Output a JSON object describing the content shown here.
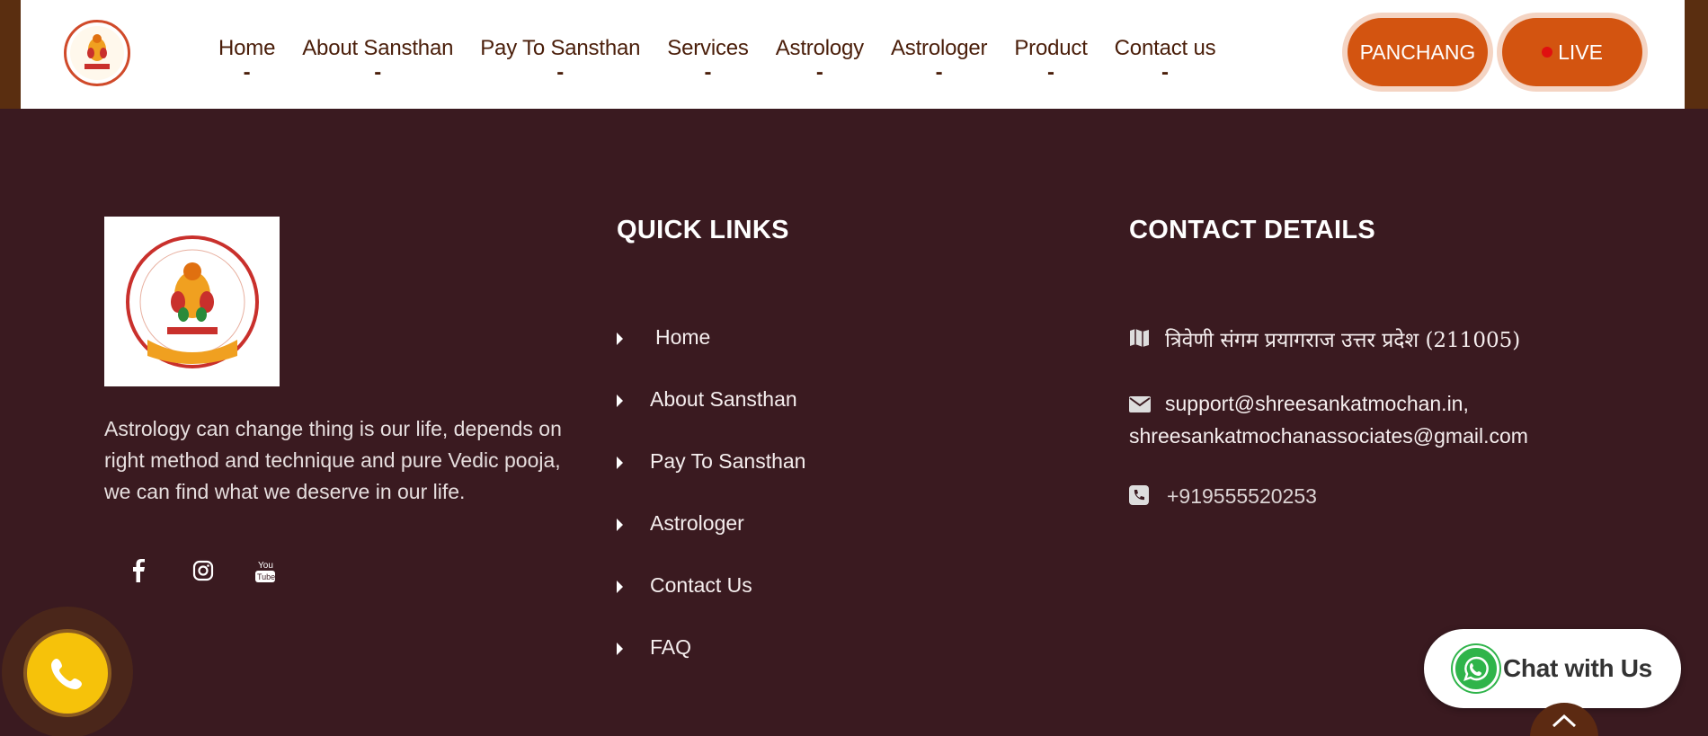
{
  "header": {
    "nav": [
      {
        "label": "Home"
      },
      {
        "label": "About Sansthan"
      },
      {
        "label": "Pay To Sansthan"
      },
      {
        "label": "Services"
      },
      {
        "label": "Astrology"
      },
      {
        "label": "Astrologer"
      },
      {
        "label": "Product"
      },
      {
        "label": "Contact us"
      }
    ],
    "dash": "-",
    "panchang_label": "PANCHANG",
    "live_label": "LIVE"
  },
  "footer": {
    "about_text": "Astrology can change thing is our life, depends on right method and technique and pure Vedic pooja, we can find what we deserve in our life.",
    "social_icons": [
      "facebook-icon",
      "instagram-icon",
      "youtube-icon"
    ],
    "quick_links_title": "QUICK LINKS",
    "quick_links": [
      "Home",
      "About Sansthan",
      "Pay To Sansthan",
      "Astrologer",
      "Contact Us",
      "FAQ"
    ],
    "contact_title": "CONTACT DETAILS",
    "address": "त्रिवेणी संगम प्रयागराज उत्तर प्रदेश (211005)",
    "email_line1": "support@shreesankatmochan.in,",
    "email_line2": "shreesankatmochanassociates@gmail.com",
    "phone": "+919555520253"
  },
  "floating": {
    "chat_label": "Chat with Us"
  },
  "colors": {
    "footer_bg": "#3a1a20",
    "accent": "#d35410",
    "nav_text": "#4a1e0a",
    "call_button": "#f6c20a",
    "whatsapp": "#2fb44a"
  }
}
